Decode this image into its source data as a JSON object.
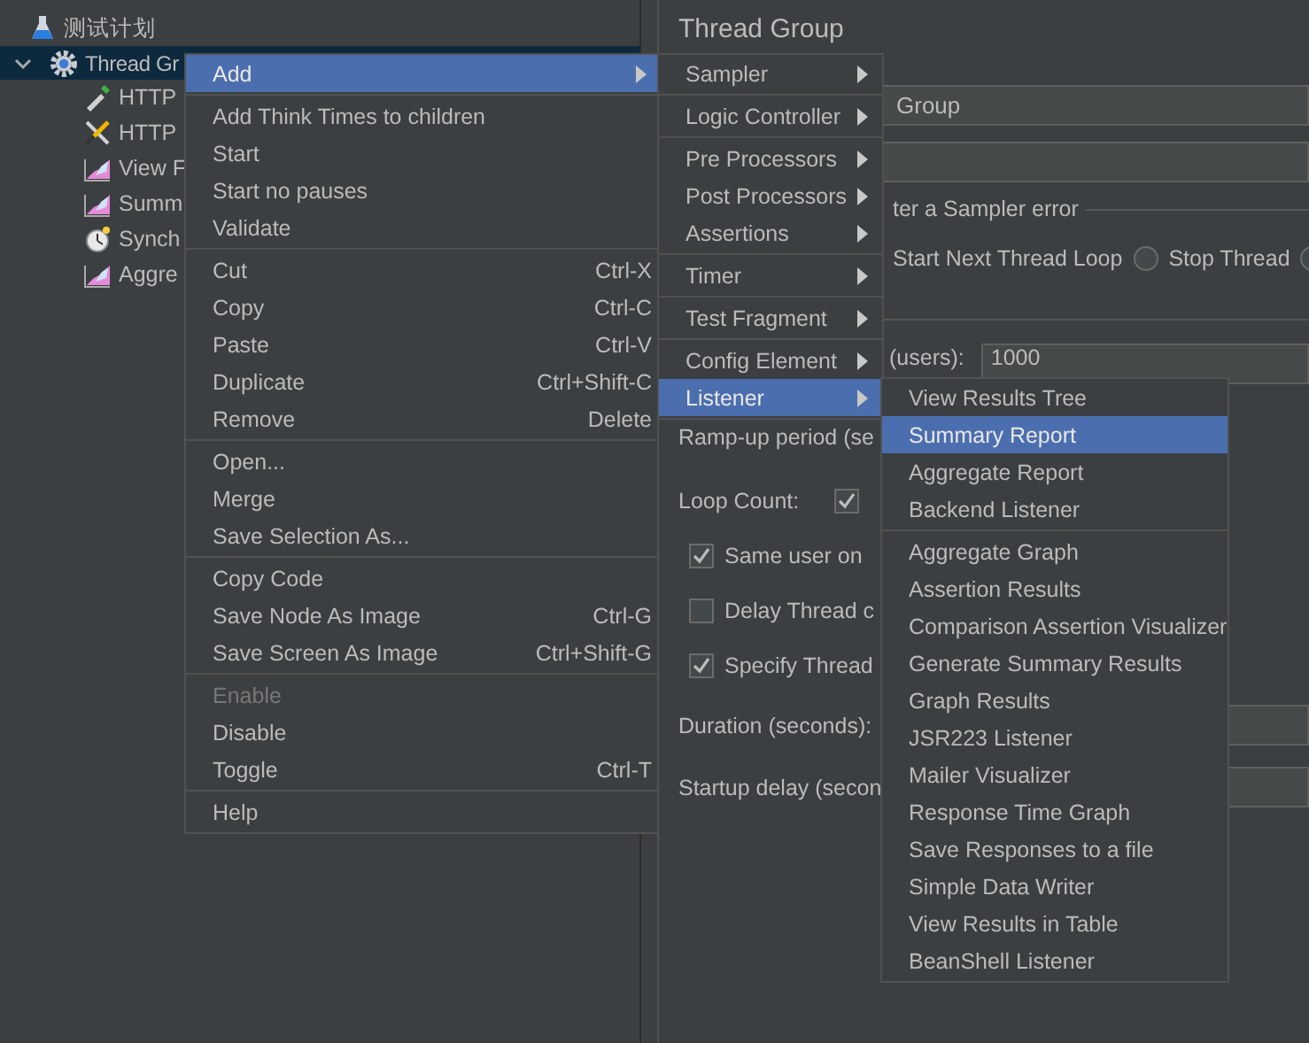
{
  "tree": [
    {
      "label": "测试计划",
      "kind": "flask",
      "selected": false,
      "children": [
        {
          "label": "Thread Gr",
          "kind": "gear",
          "selected": true,
          "expanded": true,
          "children": [
            {
              "label": "HTTP",
              "kind": "dropper",
              "selected": false
            },
            {
              "label": "HTTP",
              "kind": "tools",
              "selected": false
            },
            {
              "label": "View F",
              "kind": "chart",
              "selected": false
            },
            {
              "label": "Summ",
              "kind": "chart",
              "selected": false
            },
            {
              "label": "Synch",
              "kind": "timer",
              "selected": false
            },
            {
              "label": "Aggre",
              "kind": "chart",
              "selected": false
            }
          ]
        }
      ]
    }
  ],
  "editor": {
    "title": "Thread Group",
    "name_value": "Group",
    "error_legend": "ter a Sampler error",
    "error_actions": [
      {
        "label": "Start Next Thread Loop"
      },
      {
        "label": "Stop Thread",
        "selected": false
      },
      {
        "selected": false
      }
    ],
    "users_label": "(users):",
    "users_value": "1000",
    "ramp_label": "Ramp-up period (se",
    "loop_label": "Loop Count:",
    "loop_infinite": true,
    "options": [
      {
        "label": "Same user on",
        "checked": true
      },
      {
        "label": "Delay Thread c",
        "checked": false
      },
      {
        "label": "Specify Thread",
        "checked": true
      }
    ],
    "duration_label": "Duration (seconds):",
    "startup_label": "Startup delay (secon"
  },
  "context_menu": {
    "groups": [
      [
        {
          "label": "Add",
          "submenu": true,
          "selected": true,
          "disabled": false
        }
      ],
      [
        {
          "label": "Add Think Times to children",
          "submenu": false,
          "selected": false,
          "disabled": false
        },
        {
          "label": "Start",
          "submenu": false,
          "selected": false,
          "disabled": false
        },
        {
          "label": "Start no pauses",
          "submenu": false,
          "selected": false,
          "disabled": false
        },
        {
          "label": "Validate",
          "submenu": false,
          "selected": false,
          "disabled": false
        }
      ],
      [
        {
          "label": "Cut",
          "shortcut": "Ctrl-X",
          "submenu": false,
          "selected": false,
          "disabled": false
        },
        {
          "label": "Copy",
          "shortcut": "Ctrl-C",
          "submenu": false,
          "selected": false,
          "disabled": false
        },
        {
          "label": "Paste",
          "shortcut": "Ctrl-V",
          "submenu": false,
          "selected": false,
          "disabled": false
        },
        {
          "label": "Duplicate",
          "shortcut": "Ctrl+Shift-C",
          "submenu": false,
          "selected": false,
          "disabled": false
        },
        {
          "label": "Remove",
          "shortcut": "Delete",
          "submenu": false,
          "selected": false,
          "disabled": false
        }
      ],
      [
        {
          "label": "Open...",
          "submenu": false,
          "selected": false,
          "disabled": false
        },
        {
          "label": "Merge",
          "submenu": false,
          "selected": false,
          "disabled": false
        },
        {
          "label": "Save Selection As...",
          "submenu": false,
          "selected": false,
          "disabled": false
        }
      ],
      [
        {
          "label": "Copy Code",
          "submenu": false,
          "selected": false,
          "disabled": false
        },
        {
          "label": "Save Node As Image",
          "shortcut": "Ctrl-G",
          "submenu": false,
          "selected": false,
          "disabled": false
        },
        {
          "label": "Save Screen As Image",
          "shortcut": "Ctrl+Shift-G",
          "submenu": false,
          "selected": false,
          "disabled": false
        }
      ],
      [
        {
          "label": "Enable",
          "submenu": false,
          "selected": false,
          "disabled": true
        },
        {
          "label": "Disable",
          "submenu": false,
          "selected": false,
          "disabled": false
        },
        {
          "label": "Toggle",
          "shortcut": "Ctrl-T",
          "submenu": false,
          "selected": false,
          "disabled": false
        }
      ],
      [
        {
          "label": "Help",
          "submenu": false,
          "selected": false,
          "disabled": false
        }
      ]
    ]
  },
  "add_menu": {
    "groups": [
      [
        {
          "label": "Sampler",
          "selected": false
        }
      ],
      [
        {
          "label": "Logic Controller",
          "selected": false
        }
      ],
      [
        {
          "label": "Pre Processors",
          "selected": false
        },
        {
          "label": "Post Processors",
          "selected": false
        },
        {
          "label": "Assertions",
          "selected": false
        }
      ],
      [
        {
          "label": "Timer",
          "selected": false
        }
      ],
      [
        {
          "label": "Test Fragment",
          "selected": false
        }
      ],
      [
        {
          "label": "Config Element",
          "selected": false
        },
        {
          "label": "Listener",
          "selected": true
        }
      ]
    ]
  },
  "listener_menu": {
    "groups": [
      [
        {
          "label": "View Results Tree",
          "selected": false
        },
        {
          "label": "Summary Report",
          "selected": true
        },
        {
          "label": "Aggregate Report",
          "selected": false
        },
        {
          "label": "Backend Listener",
          "selected": false
        }
      ],
      [
        {
          "label": "Aggregate Graph",
          "selected": false
        },
        {
          "label": "Assertion Results",
          "selected": false
        },
        {
          "label": "Comparison Assertion Visualizer",
          "selected": false
        },
        {
          "label": "Generate Summary Results",
          "selected": false
        },
        {
          "label": "Graph Results",
          "selected": false
        },
        {
          "label": "JSR223 Listener",
          "selected": false
        },
        {
          "label": "Mailer Visualizer",
          "selected": false
        },
        {
          "label": "Response Time Graph",
          "selected": false
        },
        {
          "label": "Save Responses to a file",
          "selected": false
        },
        {
          "label": "Simple Data Writer",
          "selected": false
        },
        {
          "label": "View Results in Table",
          "selected": false
        },
        {
          "label": "BeanShell Listener",
          "selected": false
        }
      ]
    ]
  }
}
